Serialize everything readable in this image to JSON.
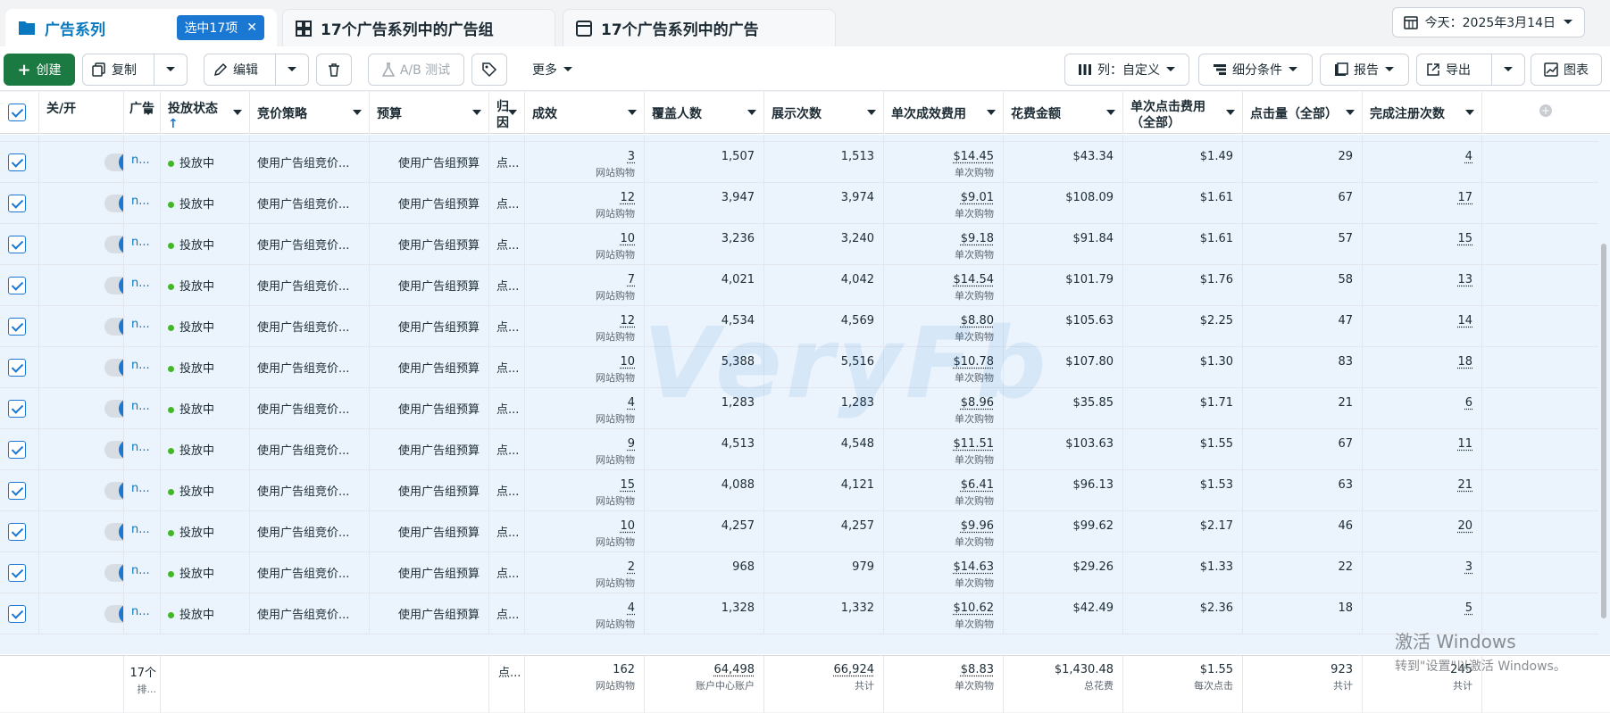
{
  "tabs": {
    "campaigns": {
      "label": "广告系列",
      "selected": "选中17项"
    },
    "adsets": {
      "label": "17个广告系列中的广告组"
    },
    "ads": {
      "label": "17个广告系列中的广告"
    }
  },
  "date_range": "今天：2025年3月14日",
  "toolbar": {
    "create": "创建",
    "copy": "复制",
    "edit": "编辑",
    "ab_test": "A/B 测试",
    "more": "更多",
    "columns": "列：自定义",
    "breakdown": "细分条件",
    "reports": "报告",
    "export": "导出",
    "charts": "图表"
  },
  "headers": {
    "onoff": "关/开",
    "name": "广告",
    "delivery": "投放状态",
    "bid": "竞价策略",
    "budget": "预算",
    "attr": "归因",
    "results": "成效",
    "reach": "覆盖人数",
    "impr": "展示次数",
    "cpr": "单次成效费用",
    "spend": "花费金额",
    "cpc": "单次点击费用（全部）",
    "clicks": "点击量（全部）",
    "reg": "完成注册次数"
  },
  "row_common": {
    "name": "n...",
    "status": "投放中",
    "bid": "使用广告组竞价...",
    "budget": "使用广告组预算",
    "attr": "点...",
    "result_sub": "网站购物",
    "cpr_sub": "单次购物"
  },
  "rows": [
    {
      "results": "3",
      "reach": "1,507",
      "impr": "1,513",
      "cpr": "$14.45",
      "spend": "$43.34",
      "cpc": "$1.49",
      "clicks": "29",
      "reg": "4"
    },
    {
      "results": "12",
      "reach": "3,947",
      "impr": "3,974",
      "cpr": "$9.01",
      "spend": "$108.09",
      "cpc": "$1.61",
      "clicks": "67",
      "reg": "17"
    },
    {
      "results": "10",
      "reach": "3,236",
      "impr": "3,240",
      "cpr": "$9.18",
      "spend": "$91.84",
      "cpc": "$1.61",
      "clicks": "57",
      "reg": "15"
    },
    {
      "results": "7",
      "reach": "4,021",
      "impr": "4,042",
      "cpr": "$14.54",
      "spend": "$101.79",
      "cpc": "$1.76",
      "clicks": "58",
      "reg": "13"
    },
    {
      "results": "12",
      "reach": "4,534",
      "impr": "4,569",
      "cpr": "$8.80",
      "spend": "$105.63",
      "cpc": "$2.25",
      "clicks": "47",
      "reg": "14"
    },
    {
      "results": "10",
      "reach": "5,388",
      "impr": "5,516",
      "cpr": "$10.78",
      "spend": "$107.80",
      "cpc": "$1.30",
      "clicks": "83",
      "reg": "18"
    },
    {
      "results": "4",
      "reach": "1,283",
      "impr": "1,283",
      "cpr": "$8.96",
      "spend": "$35.85",
      "cpc": "$1.71",
      "clicks": "21",
      "reg": "6"
    },
    {
      "results": "9",
      "reach": "4,513",
      "impr": "4,548",
      "cpr": "$11.51",
      "spend": "$103.63",
      "cpc": "$1.55",
      "clicks": "67",
      "reg": "11"
    },
    {
      "results": "15",
      "reach": "4,088",
      "impr": "4,121",
      "cpr": "$6.41",
      "spend": "$96.13",
      "cpc": "$1.53",
      "clicks": "63",
      "reg": "21"
    },
    {
      "results": "10",
      "reach": "4,257",
      "impr": "4,257",
      "cpr": "$9.96",
      "spend": "$99.62",
      "cpc": "$2.17",
      "clicks": "46",
      "reg": "20"
    },
    {
      "results": "2",
      "reach": "968",
      "impr": "979",
      "cpr": "$14.63",
      "spend": "$29.26",
      "cpc": "$1.33",
      "clicks": "22",
      "reg": "3"
    },
    {
      "results": "4",
      "reach": "1,328",
      "impr": "1,332",
      "cpr": "$10.62",
      "spend": "$42.49",
      "cpc": "$2.36",
      "clicks": "18",
      "reg": "5"
    }
  ],
  "totals": {
    "name": "17个",
    "name_sub": "排...",
    "attr": "点...",
    "results": "162",
    "results_sub": "网站购物",
    "reach": "64,498",
    "reach_sub": "账户中心账户",
    "impr": "66,924",
    "impr_sub": "共计",
    "cpr": "$8.83",
    "cpr_sub": "单次购物",
    "spend": "$1,430.48",
    "spend_sub": "总花费",
    "cpc": "$1.55",
    "cpc_sub": "每次点击",
    "clicks": "923",
    "clicks_sub": "共计",
    "reg": "245",
    "reg_sub": "共计"
  },
  "watermark": "VeryFb",
  "windows_activation": {
    "title": "激活 Windows",
    "subtitle": "转到\"设置\"以激活 Windows。"
  }
}
